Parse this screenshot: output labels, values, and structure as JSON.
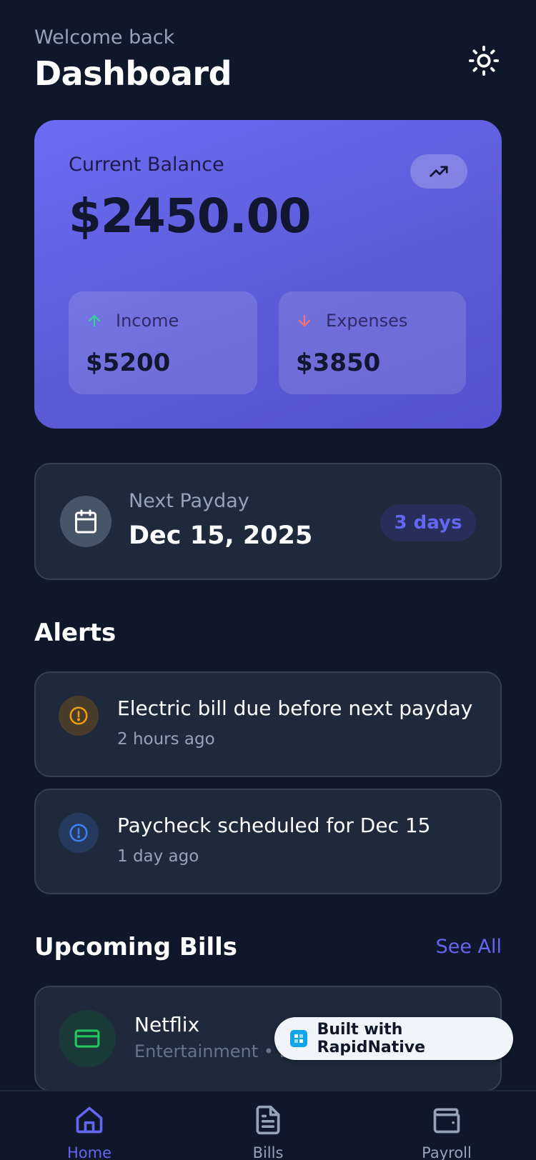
{
  "header": {
    "welcome": "Welcome back",
    "title": "Dashboard"
  },
  "balance": {
    "label": "Current Balance",
    "value": "$2450.00",
    "income_label": "Income",
    "income_value": "$5200",
    "expenses_label": "Expenses",
    "expenses_value": "$3850"
  },
  "payday": {
    "label": "Next Payday",
    "date": "Dec 15, 2025",
    "countdown": "3 days"
  },
  "alerts": {
    "title": "Alerts",
    "items": [
      {
        "text": "Electric bill due before next payday",
        "time": "2 hours ago",
        "kind": "warning"
      },
      {
        "text": "Paycheck scheduled for Dec 15",
        "time": "1 day ago",
        "kind": "info"
      }
    ]
  },
  "bills": {
    "title": "Upcoming Bills",
    "see_all": "See All",
    "items": [
      {
        "name": "Netflix",
        "meta": "Entertainment • Du"
      }
    ]
  },
  "badge": {
    "text": "Built with RapidNative"
  },
  "tabs": [
    {
      "label": "Home",
      "icon": "home-icon",
      "active": true
    },
    {
      "label": "Bills",
      "icon": "document-icon",
      "active": false
    },
    {
      "label": "Payroll",
      "icon": "wallet-icon",
      "active": false
    }
  ],
  "colors": {
    "background": "#0f172a",
    "card": "#1e293b",
    "accent": "#6366f1",
    "income": "#34d399",
    "expense": "#f87171",
    "warning": "#f59e0b",
    "info": "#3b82f6",
    "bill_green": "#22c55e"
  }
}
